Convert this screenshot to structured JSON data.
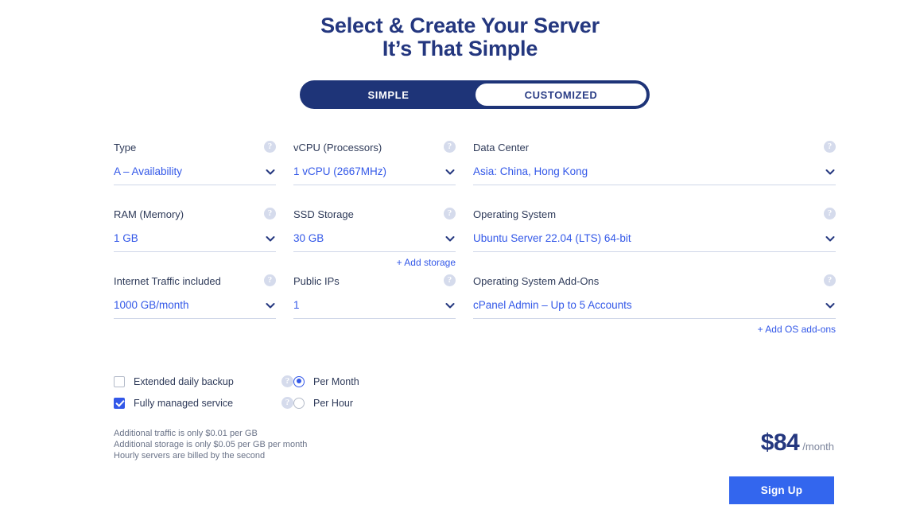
{
  "heading": {
    "line1": "Select & Create Your Server",
    "line2": "It’s That Simple"
  },
  "mode_toggle": {
    "simple_label": "SIMPLE",
    "customized_label": "CUSTOMIZED",
    "selected": "SIMPLE"
  },
  "help_glyph": "?",
  "fields": {
    "type": {
      "label": "Type",
      "value": "A – Availability"
    },
    "vcpu": {
      "label": "vCPU (Processors)",
      "value": "1 vCPU (2667MHz)"
    },
    "datacenter": {
      "label": "Data Center",
      "value": "Asia: China, Hong Kong"
    },
    "ram": {
      "label": "RAM (Memory)",
      "value": "1 GB"
    },
    "ssd": {
      "label": "SSD Storage",
      "value": "30 GB",
      "add_link": "+ Add storage"
    },
    "os": {
      "label": "Operating System",
      "value": "Ubuntu Server 22.04 (LTS) 64-bit"
    },
    "traffic": {
      "label": "Internet Traffic included",
      "value": "1000 GB/month"
    },
    "public_ips": {
      "label": "Public IPs",
      "value": "1"
    },
    "os_addons": {
      "label": "Operating System Add-Ons",
      "value": "cPanel Admin – Up to 5 Accounts",
      "add_link": "+ Add OS add-ons"
    }
  },
  "options": {
    "checkboxes": [
      {
        "label": "Extended daily backup",
        "checked": false
      },
      {
        "label": "Fully managed service",
        "checked": true
      }
    ],
    "billing": [
      {
        "label": "Per Month",
        "selected": true
      },
      {
        "label": "Per Hour",
        "selected": false
      }
    ]
  },
  "notes": [
    "Additional traffic is only $0.01 per GB",
    "Additional storage is only $0.05 per GB per month",
    "Hourly servers are billed by the second"
  ],
  "price": {
    "amount": "$84",
    "period": "/month"
  },
  "signup": {
    "label": "Sign Up"
  },
  "colors": {
    "navy": "#24377f",
    "toggle_bg": "#1e3478",
    "link_blue": "#3358e8",
    "button_blue": "#3366ee",
    "label_text": "#2e3a59",
    "underline": "#cfd6e8",
    "help_bg": "#d5dbec",
    "note_text": "#6a7388"
  }
}
